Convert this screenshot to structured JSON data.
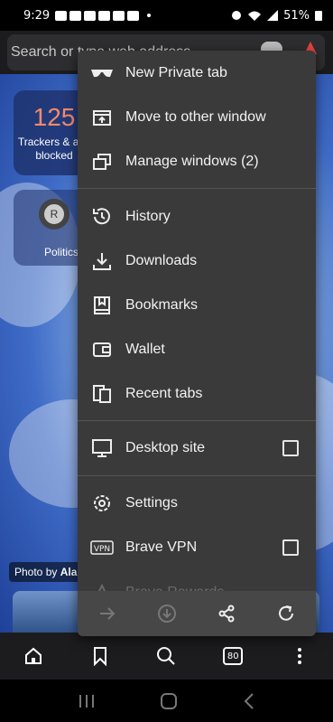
{
  "status_bar": {
    "time": "9:29",
    "battery": "51%"
  },
  "url_bar": {
    "placeholder": "Search or type web address"
  },
  "new_tab_page": {
    "trackers_count": "125",
    "trackers_label": "Trackers & ads blocked",
    "site_avatar_letter": "R",
    "site_label": "Politics",
    "photo_credit_prefix": "Photo by",
    "photo_credit_name": "Ala"
  },
  "menu": {
    "items": [
      {
        "label": "New Private tab",
        "icon": "private-tab-icon"
      },
      {
        "label": "Move to other window",
        "icon": "move-window-icon"
      },
      {
        "label": "Manage windows (2)",
        "icon": "manage-windows-icon"
      },
      {
        "label": "History",
        "icon": "history-icon"
      },
      {
        "label": "Downloads",
        "icon": "downloads-icon"
      },
      {
        "label": "Bookmarks",
        "icon": "bookmarks-icon"
      },
      {
        "label": "Wallet",
        "icon": "wallet-icon"
      },
      {
        "label": "Recent tabs",
        "icon": "recent-tabs-icon"
      },
      {
        "label": "Desktop site",
        "icon": "desktop-site-icon",
        "checked": false
      },
      {
        "label": "Settings",
        "icon": "settings-icon"
      },
      {
        "label": "Brave VPN",
        "icon": "vpn-icon",
        "checked": false
      },
      {
        "label": "Brave Rewards",
        "icon": "rewards-icon"
      }
    ]
  },
  "toolbar": {
    "tab_count": "80"
  },
  "colors": {
    "menu_bg": "#3a3a3a",
    "accent_tracker": "#f58a6a"
  }
}
